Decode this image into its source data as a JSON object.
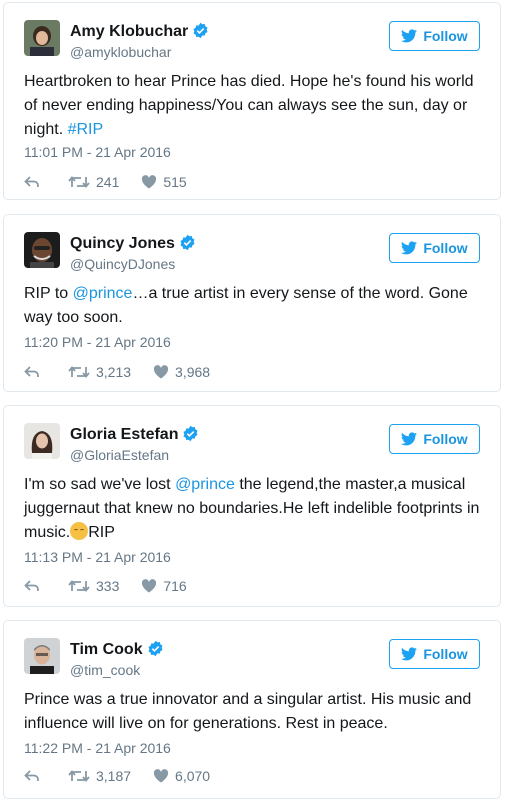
{
  "colors": {
    "link": "#1b95e0",
    "border": "#e1e8ed",
    "muted": "#657786",
    "verified": "#1da1f2"
  },
  "icons": {
    "verified": "verified-badge-icon",
    "follow": "twitter-bird-icon",
    "reply": "reply-icon",
    "retweet": "retweet-icon",
    "like": "heart-icon"
  },
  "tweets": [
    {
      "name": "Amy Klobuchar",
      "handle": "@amyklobuchar",
      "follow_label": "Follow",
      "text_before": "Heartbroken to hear Prince has died. Hope he's found his world of never ending happiness/You can always see the sun, day or night. ",
      "link": "#RIP",
      "text_after": "",
      "time": "11:01 PM - 21 Apr 2016",
      "retweets": "241",
      "likes": "515"
    },
    {
      "name": "Quincy Jones",
      "handle": "@QuincyDJones",
      "follow_label": "Follow",
      "text_before": "RIP to ",
      "link": "@prince",
      "text_after": "…a true artist in every sense of the word. Gone way too soon.",
      "time": "11:20 PM - 21 Apr 2016",
      "retweets": "3,213",
      "likes": "3,968"
    },
    {
      "name": "Gloria Estefan",
      "handle": "@GloriaEstefan",
      "follow_label": "Follow",
      "text_before": "I'm so sad we've lost ",
      "link": "@prince",
      "text_after": " the legend,the master,a musical juggernaut that knew no boundaries.He left indelible footprints in music.",
      "text_end": "RIP",
      "time": "11:13 PM - 21 Apr 2016",
      "retweets": "333",
      "likes": "716"
    },
    {
      "name": "Tim Cook",
      "handle": "@tim_cook",
      "follow_label": "Follow",
      "text_before": "Prince was a true innovator and a singular artist. His music and influence will live on for generations. Rest in peace.",
      "link": "",
      "text_after": "",
      "time": "11:22 PM - 21 Apr 2016",
      "retweets": "3,187",
      "likes": "6,070"
    }
  ]
}
